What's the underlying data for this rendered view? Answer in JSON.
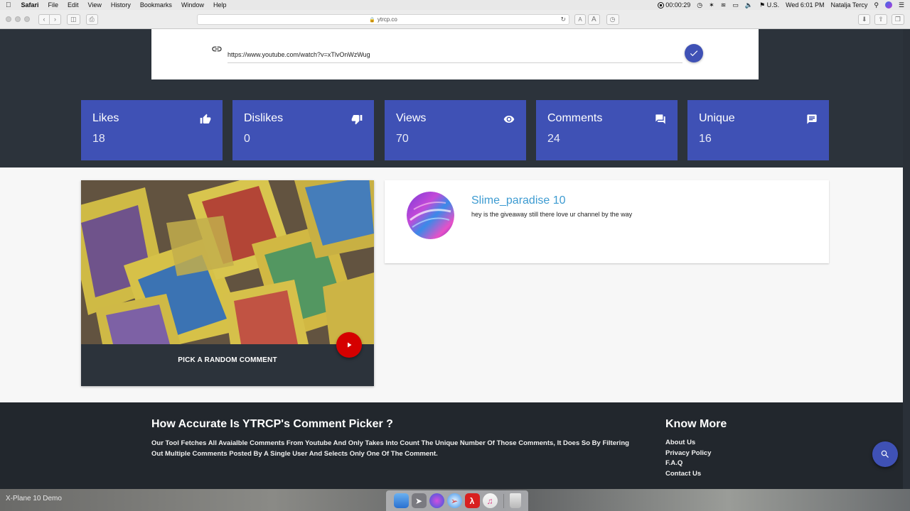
{
  "menubar": {
    "app_name": "Safari",
    "items": [
      "File",
      "Edit",
      "View",
      "History",
      "Bookmarks",
      "Window",
      "Help"
    ],
    "recording_time": "00:00:29",
    "input_source": "U.S.",
    "datetime": "Wed 6:01 PM",
    "user": "Natalja Tercy"
  },
  "browser": {
    "address": "ytrcp.co"
  },
  "url_form": {
    "url_value": "https://www.youtube.com/watch?v=xTlvOnWzWug"
  },
  "stats": [
    {
      "label": "Likes",
      "value": "18",
      "icon": "thumb-up-icon"
    },
    {
      "label": "Dislikes",
      "value": "0",
      "icon": "thumb-down-icon"
    },
    {
      "label": "Views",
      "value": "70",
      "icon": "eye-icon"
    },
    {
      "label": "Comments",
      "value": "24",
      "icon": "forum-icon"
    },
    {
      "label": "Unique",
      "value": "16",
      "icon": "comment-icon"
    }
  ],
  "video": {
    "pick_label": "PICK A RANDOM COMMENT"
  },
  "comment": {
    "author": "Slime_paradise 10",
    "text": "hey is the giveaway still there love ur channel by the way"
  },
  "footer": {
    "title": "How Accurate Is YTRCP's Comment Picker ?",
    "text": "Our Tool Fetches All Avaialble Comments From Youtube And Only Takes Into Count The Unique Number Of Those Comments, It Does So By Filtering Out Multiple Comments Posted By A Single User And Selects Only One Of The Comment.",
    "know_more_title": "Know More",
    "links": [
      "About Us",
      "Privacy Policy",
      "F.A.Q",
      "Contact Us"
    ]
  },
  "desktop": {
    "label": "X-Plane 10 Demo"
  },
  "colors": {
    "primary": "#3f51b5",
    "dark": "#2c333b",
    "footer": "#22272d",
    "play": "#d50000",
    "author": "#3d9bd1"
  }
}
